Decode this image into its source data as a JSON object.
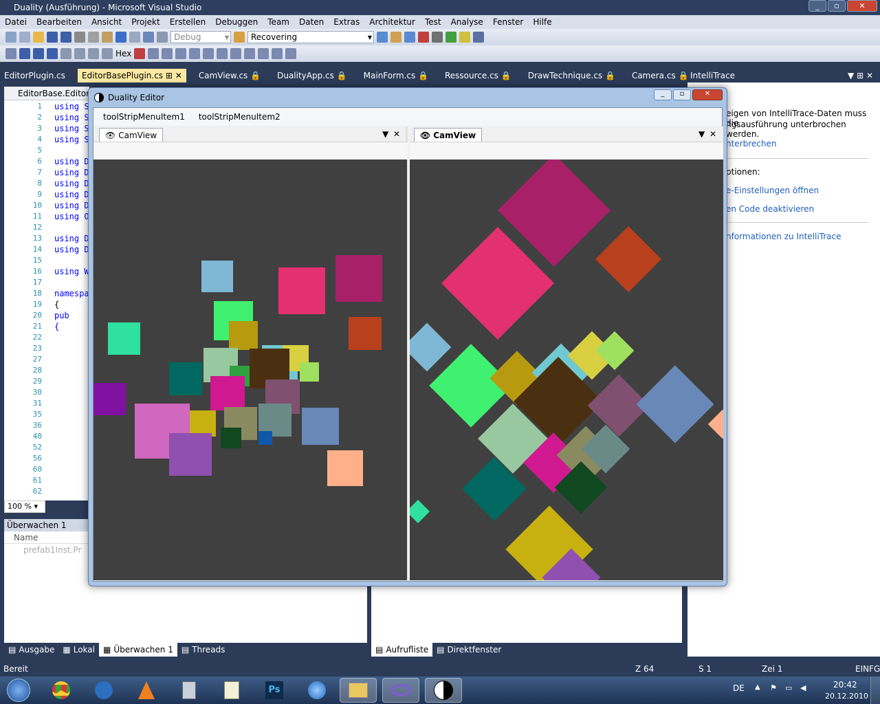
{
  "window": {
    "title": "Duality (Ausführung) - Microsoft Visual Studio"
  },
  "menu": [
    "Datei",
    "Bearbeiten",
    "Ansicht",
    "Projekt",
    "Erstellen",
    "Debuggen",
    "Team",
    "Daten",
    "Extras",
    "Architektur",
    "Test",
    "Analyse",
    "Fenster",
    "Hilfe"
  ],
  "toolbar": {
    "config": "Debug",
    "search": "Recovering",
    "hex_label": "Hex"
  },
  "doc_tabs": [
    "EditorPlugin.cs",
    "EditorBasePlugin.cs",
    "CamView.cs",
    "DualityApp.cs",
    "MainForm.cs",
    "Ressource.cs",
    "DrawTechnique.cs",
    "Camera.cs"
  ],
  "editor": {
    "nav": "EditorBase.EditorBa",
    "zoom": "100 %",
    "line_numbers": [
      "1",
      "2",
      "3",
      "4",
      "5",
      "6",
      "7",
      "8",
      "9",
      "10",
      "11",
      "12",
      "13",
      "14",
      "15",
      "16",
      "17",
      "18",
      "19",
      "20",
      "21",
      "22",
      "23",
      "27",
      "28",
      "29",
      "30",
      "31",
      "35",
      "36",
      "40",
      "52",
      "56",
      "60",
      "61",
      "62"
    ],
    "code_lines": [
      "using S",
      "using S",
      "using S",
      "using S",
      "",
      "using D",
      "using D",
      "using D",
      "using D",
      "using D",
      "using O",
      "",
      "using D",
      "using D",
      "",
      "using W",
      "",
      "namespa",
      "{",
      "  pub",
      "  {",
      "",
      "",
      "",
      "",
      "",
      "",
      "",
      "",
      "",
      "",
      "",
      "",
      "",
      "",
      ""
    ]
  },
  "watch": {
    "title": "Überwachen 1",
    "col_name": "Name",
    "item": "prefab1Inst.Pr"
  },
  "bottom_tabs_left": [
    "Ausgabe",
    "Lokal",
    "Überwachen 1",
    "Threads"
  ],
  "bottom_tabs_right": [
    "Aufrufliste",
    "Direktfenster"
  ],
  "intellitrace": {
    "title": "IntelliTrace",
    "msg1": "eigen von IntelliTrace-Daten muss die",
    "msg2": "ngsausführung unterbrochen werden.",
    "link1": "nterbrechen",
    "options": "ptionen:",
    "link2": "e-Einstellungen öffnen",
    "link3": "en Code deaktivieren",
    "link4": "nformationen zu IntelliTrace"
  },
  "dialog": {
    "title": "Duality Editor",
    "menu_items": [
      "toolStripMenuItem1",
      "toolStripMenuItem2"
    ],
    "pane_left_tab": "CamView",
    "pane_right_tab": "CamView"
  },
  "status": {
    "left": "Bereit",
    "line": "Z 64",
    "col": "S 1",
    "char": "Zei 1",
    "mode": "EINFG"
  },
  "tray": {
    "lang": "DE",
    "time": "20:42",
    "date": "20.12.2010"
  },
  "icons": [
    "start-orb",
    "chrome-icon",
    "thunderbird-icon",
    "vlc-icon",
    "calculator-icon",
    "notepad-icon",
    "photoshop-icon",
    "itunes-icon",
    "explorer-icon",
    "visual-studio-icon",
    "duality-icon"
  ],
  "colors": {
    "accent": "#2b3b58",
    "active_tab": "#fbe9a3",
    "canvas": "#404040"
  }
}
